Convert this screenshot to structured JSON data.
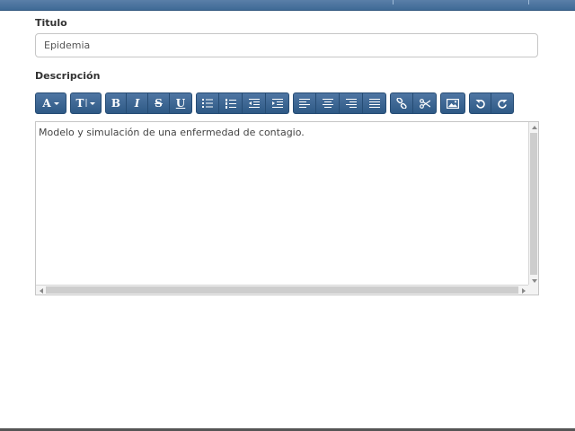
{
  "form": {
    "title_label": "Titulo",
    "title_value": "Epidemia",
    "description_label": "Descripción",
    "description_text": "Modelo y simulación de una enfermedad de contagio."
  },
  "toolbar": {
    "font_button": "A",
    "font_size_button": "T",
    "bold": "B",
    "italic": "I",
    "strike": "S",
    "underline": "U",
    "icons": [
      "font-icon",
      "text-height-icon",
      "bold-icon",
      "italic-icon",
      "strikethrough-icon",
      "underline-icon",
      "bullet-list-icon",
      "numbered-list-icon",
      "outdent-icon",
      "indent-icon",
      "align-left-icon",
      "align-center-icon",
      "align-right-icon",
      "align-justify-icon",
      "link-icon",
      "cut-icon",
      "image-icon",
      "undo-icon",
      "redo-icon"
    ]
  },
  "colors": {
    "button_bg": "#3e6894",
    "header_bar": "#4a73a0"
  }
}
